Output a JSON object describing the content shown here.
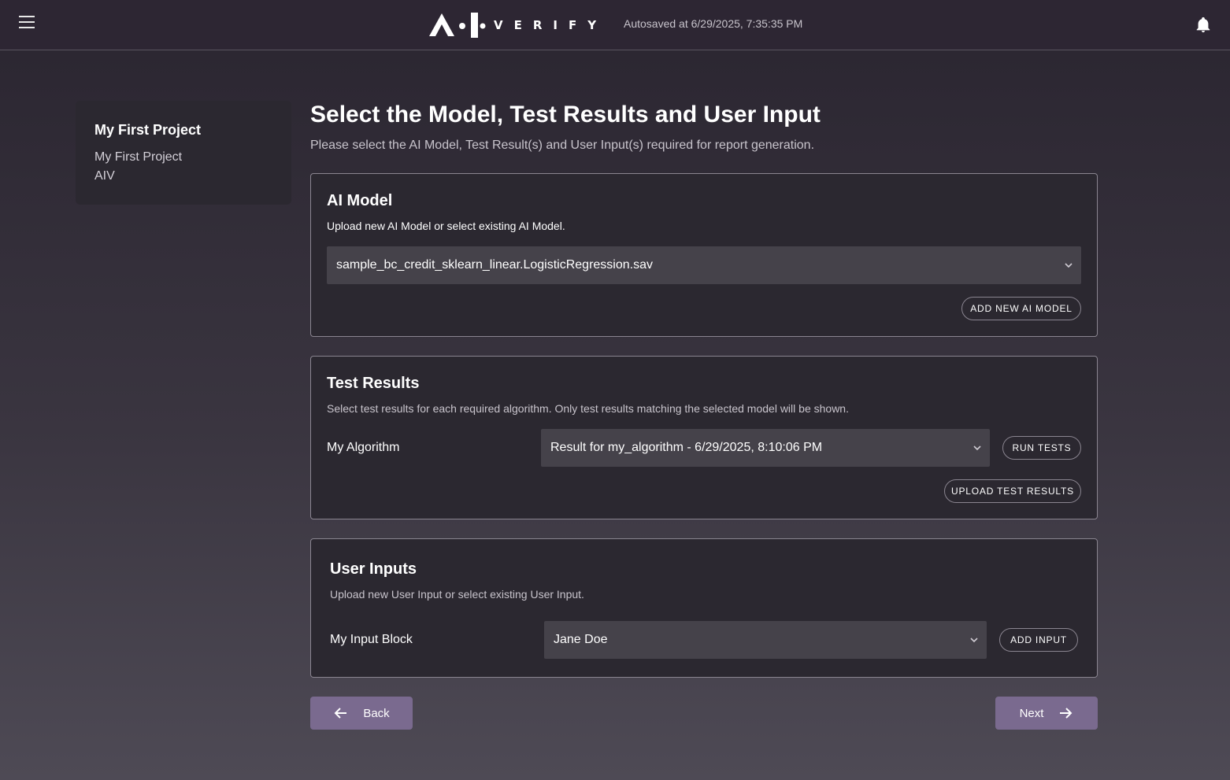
{
  "header": {
    "logo_text": "VERIFY",
    "autosave": "Autosaved at 6/29/2025, 7:35:35 PM"
  },
  "sidebar": {
    "project_title": "My First Project",
    "project_name": "My First Project",
    "project_sub": "AIV"
  },
  "main": {
    "title": "Select the Model, Test Results and User Input",
    "description": "Please select the AI Model, Test Result(s) and User Input(s) required for report generation."
  },
  "ai_model": {
    "title": "AI Model",
    "description": "Upload new AI Model or select existing AI Model.",
    "selected": "sample_bc_credit_sklearn_linear.LogisticRegression.sav",
    "add_button": "ADD NEW AI MODEL"
  },
  "test_results": {
    "title": "Test Results",
    "description": "Select test results for each required algorithm. Only test results matching the selected model will be shown.",
    "algorithm_label": "My Algorithm",
    "selected": "Result for my_algorithm - 6/29/2025, 8:10:06 PM",
    "run_button": "RUN TESTS",
    "upload_button": "UPLOAD TEST RESULTS"
  },
  "user_inputs": {
    "title": "User Inputs",
    "description": "Upload new User Input or select existing User Input.",
    "block_label": "My Input Block",
    "selected": "Jane Doe",
    "add_button": "ADD INPUT"
  },
  "footer": {
    "back_label": "Back",
    "next_label": "Next"
  },
  "colors": {
    "accent_button": "#7a6a8f",
    "panel_bg": "#2b2830",
    "select_bg": "#45424a"
  }
}
